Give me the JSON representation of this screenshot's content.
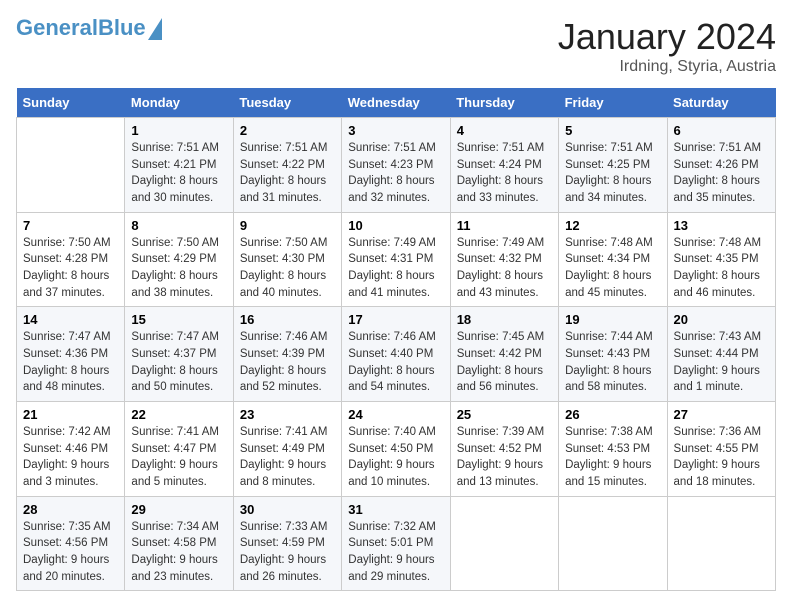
{
  "logo": {
    "line1": "General",
    "line2": "Blue"
  },
  "title": "January 2024",
  "subtitle": "Irdning, Styria, Austria",
  "days_header": [
    "Sunday",
    "Monday",
    "Tuesday",
    "Wednesday",
    "Thursday",
    "Friday",
    "Saturday"
  ],
  "weeks": [
    [
      {
        "day": "",
        "sunrise": "",
        "sunset": "",
        "daylight": ""
      },
      {
        "day": "1",
        "sunrise": "Sunrise: 7:51 AM",
        "sunset": "Sunset: 4:21 PM",
        "daylight": "Daylight: 8 hours and 30 minutes."
      },
      {
        "day": "2",
        "sunrise": "Sunrise: 7:51 AM",
        "sunset": "Sunset: 4:22 PM",
        "daylight": "Daylight: 8 hours and 31 minutes."
      },
      {
        "day": "3",
        "sunrise": "Sunrise: 7:51 AM",
        "sunset": "Sunset: 4:23 PM",
        "daylight": "Daylight: 8 hours and 32 minutes."
      },
      {
        "day": "4",
        "sunrise": "Sunrise: 7:51 AM",
        "sunset": "Sunset: 4:24 PM",
        "daylight": "Daylight: 8 hours and 33 minutes."
      },
      {
        "day": "5",
        "sunrise": "Sunrise: 7:51 AM",
        "sunset": "Sunset: 4:25 PM",
        "daylight": "Daylight: 8 hours and 34 minutes."
      },
      {
        "day": "6",
        "sunrise": "Sunrise: 7:51 AM",
        "sunset": "Sunset: 4:26 PM",
        "daylight": "Daylight: 8 hours and 35 minutes."
      }
    ],
    [
      {
        "day": "7",
        "sunrise": "Sunrise: 7:50 AM",
        "sunset": "Sunset: 4:28 PM",
        "daylight": "Daylight: 8 hours and 37 minutes."
      },
      {
        "day": "8",
        "sunrise": "Sunrise: 7:50 AM",
        "sunset": "Sunset: 4:29 PM",
        "daylight": "Daylight: 8 hours and 38 minutes."
      },
      {
        "day": "9",
        "sunrise": "Sunrise: 7:50 AM",
        "sunset": "Sunset: 4:30 PM",
        "daylight": "Daylight: 8 hours and 40 minutes."
      },
      {
        "day": "10",
        "sunrise": "Sunrise: 7:49 AM",
        "sunset": "Sunset: 4:31 PM",
        "daylight": "Daylight: 8 hours and 41 minutes."
      },
      {
        "day": "11",
        "sunrise": "Sunrise: 7:49 AM",
        "sunset": "Sunset: 4:32 PM",
        "daylight": "Daylight: 8 hours and 43 minutes."
      },
      {
        "day": "12",
        "sunrise": "Sunrise: 7:48 AM",
        "sunset": "Sunset: 4:34 PM",
        "daylight": "Daylight: 8 hours and 45 minutes."
      },
      {
        "day": "13",
        "sunrise": "Sunrise: 7:48 AM",
        "sunset": "Sunset: 4:35 PM",
        "daylight": "Daylight: 8 hours and 46 minutes."
      }
    ],
    [
      {
        "day": "14",
        "sunrise": "Sunrise: 7:47 AM",
        "sunset": "Sunset: 4:36 PM",
        "daylight": "Daylight: 8 hours and 48 minutes."
      },
      {
        "day": "15",
        "sunrise": "Sunrise: 7:47 AM",
        "sunset": "Sunset: 4:37 PM",
        "daylight": "Daylight: 8 hours and 50 minutes."
      },
      {
        "day": "16",
        "sunrise": "Sunrise: 7:46 AM",
        "sunset": "Sunset: 4:39 PM",
        "daylight": "Daylight: 8 hours and 52 minutes."
      },
      {
        "day": "17",
        "sunrise": "Sunrise: 7:46 AM",
        "sunset": "Sunset: 4:40 PM",
        "daylight": "Daylight: 8 hours and 54 minutes."
      },
      {
        "day": "18",
        "sunrise": "Sunrise: 7:45 AM",
        "sunset": "Sunset: 4:42 PM",
        "daylight": "Daylight: 8 hours and 56 minutes."
      },
      {
        "day": "19",
        "sunrise": "Sunrise: 7:44 AM",
        "sunset": "Sunset: 4:43 PM",
        "daylight": "Daylight: 8 hours and 58 minutes."
      },
      {
        "day": "20",
        "sunrise": "Sunrise: 7:43 AM",
        "sunset": "Sunset: 4:44 PM",
        "daylight": "Daylight: 9 hours and 1 minute."
      }
    ],
    [
      {
        "day": "21",
        "sunrise": "Sunrise: 7:42 AM",
        "sunset": "Sunset: 4:46 PM",
        "daylight": "Daylight: 9 hours and 3 minutes."
      },
      {
        "day": "22",
        "sunrise": "Sunrise: 7:41 AM",
        "sunset": "Sunset: 4:47 PM",
        "daylight": "Daylight: 9 hours and 5 minutes."
      },
      {
        "day": "23",
        "sunrise": "Sunrise: 7:41 AM",
        "sunset": "Sunset: 4:49 PM",
        "daylight": "Daylight: 9 hours and 8 minutes."
      },
      {
        "day": "24",
        "sunrise": "Sunrise: 7:40 AM",
        "sunset": "Sunset: 4:50 PM",
        "daylight": "Daylight: 9 hours and 10 minutes."
      },
      {
        "day": "25",
        "sunrise": "Sunrise: 7:39 AM",
        "sunset": "Sunset: 4:52 PM",
        "daylight": "Daylight: 9 hours and 13 minutes."
      },
      {
        "day": "26",
        "sunrise": "Sunrise: 7:38 AM",
        "sunset": "Sunset: 4:53 PM",
        "daylight": "Daylight: 9 hours and 15 minutes."
      },
      {
        "day": "27",
        "sunrise": "Sunrise: 7:36 AM",
        "sunset": "Sunset: 4:55 PM",
        "daylight": "Daylight: 9 hours and 18 minutes."
      }
    ],
    [
      {
        "day": "28",
        "sunrise": "Sunrise: 7:35 AM",
        "sunset": "Sunset: 4:56 PM",
        "daylight": "Daylight: 9 hours and 20 minutes."
      },
      {
        "day": "29",
        "sunrise": "Sunrise: 7:34 AM",
        "sunset": "Sunset: 4:58 PM",
        "daylight": "Daylight: 9 hours and 23 minutes."
      },
      {
        "day": "30",
        "sunrise": "Sunrise: 7:33 AM",
        "sunset": "Sunset: 4:59 PM",
        "daylight": "Daylight: 9 hours and 26 minutes."
      },
      {
        "day": "31",
        "sunrise": "Sunrise: 7:32 AM",
        "sunset": "Sunset: 5:01 PM",
        "daylight": "Daylight: 9 hours and 29 minutes."
      },
      {
        "day": "",
        "sunrise": "",
        "sunset": "",
        "daylight": ""
      },
      {
        "day": "",
        "sunrise": "",
        "sunset": "",
        "daylight": ""
      },
      {
        "day": "",
        "sunrise": "",
        "sunset": "",
        "daylight": ""
      }
    ]
  ]
}
